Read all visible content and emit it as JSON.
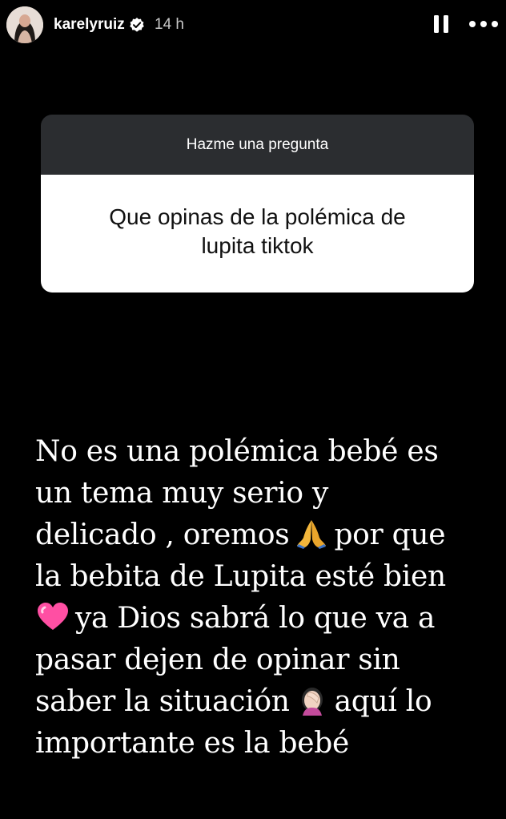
{
  "header": {
    "username": "karelyruiz",
    "time_ago": "14 h",
    "avatar_icon": "profile-avatar",
    "verified_icon": "verified-badge-icon",
    "pause_icon": "pause-icon",
    "more_icon": "more-options-icon"
  },
  "question_sticker": {
    "title": "Hazme una pregunta",
    "question": "Que opinas de la polémica de lupita tiktok"
  },
  "answer": {
    "lines": [
      "No es una polémica bebé es",
      "un tema muy serio y",
      "delicado , oremos",
      "por que",
      "la bebita de Lupita esté bien",
      "ya Dios sabrá lo que va a",
      "pasar dejen de opinar sin",
      "saber la situación",
      "aquí lo",
      "importante es la bebé"
    ],
    "emojis": [
      "praying-hands-emoji",
      "pink-heart-emoji",
      "facepalm-emoji"
    ]
  },
  "colors": {
    "background": "#000000",
    "sticker_header": "#2b2d30",
    "sticker_body": "#ffffff",
    "heart": "#ff4fa3",
    "hands": "#f3b63b"
  }
}
